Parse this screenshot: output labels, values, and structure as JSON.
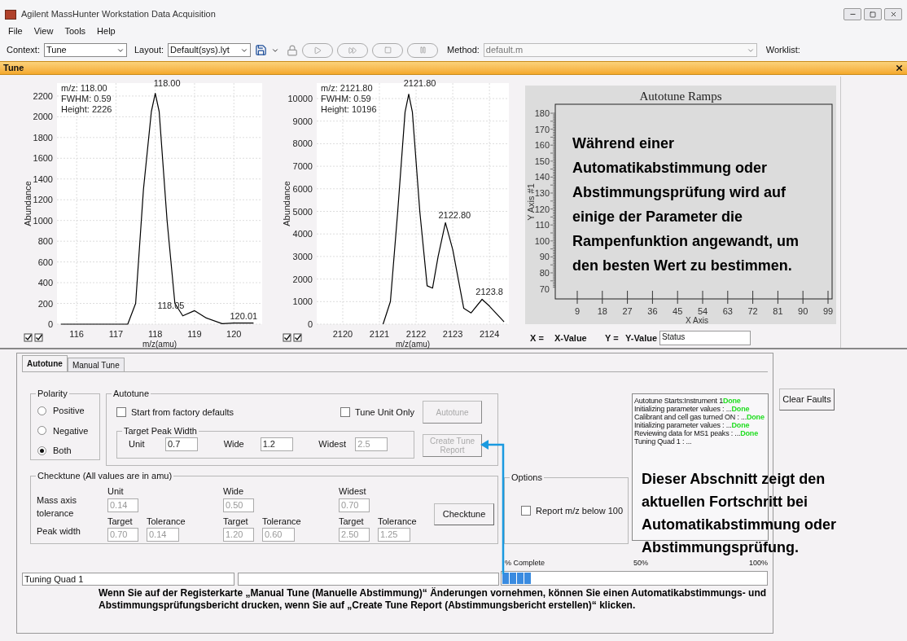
{
  "window": {
    "title": "Agilent MassHunter Workstation Data Acquisition"
  },
  "menu": [
    "File",
    "View",
    "Tools",
    "Help"
  ],
  "toolbar": {
    "context_label": "Context:",
    "context": "Tune",
    "layout_label": "Layout:",
    "layout": "Default(sys).lyt",
    "method_label": "Method:",
    "method": "default.m",
    "worklist_label": "Worklist:"
  },
  "panel_title": "Tune",
  "spectra": [
    {
      "info": [
        "m/z: 118.00",
        "FWHM: 0.59",
        "Height: 2226"
      ],
      "checks": [
        {
          "checked": true
        },
        {
          "checked": true
        }
      ],
      "chart_data": {
        "type": "line",
        "xlabel": "m/z(amu)",
        "ylabel": "Abundance",
        "x": [
          115.6,
          117.3,
          117.5,
          117.7,
          117.9,
          118.0,
          118.1,
          118.3,
          118.5,
          118.7,
          119.0,
          119.3,
          119.7,
          120.0,
          120.5
        ],
        "series": [
          {
            "color": "#000000",
            "values": [
              0,
              0,
              200,
              1300,
              2050,
              2226,
              2050,
              1000,
              200,
              80,
              130,
              60,
              5,
              10,
              10
            ]
          }
        ],
        "xlim": [
          115.5,
          120.72
        ],
        "ylim": [
          0,
          2325
        ],
        "xticks": [
          116,
          117,
          118,
          119,
          120
        ],
        "yticks": [
          0,
          200,
          400,
          600,
          800,
          1000,
          1200,
          1400,
          1600,
          1800,
          2000,
          2200
        ],
        "grid": true,
        "annotations": [
          "118.00",
          "118.05",
          "120.01"
        ]
      }
    },
    {
      "info": [
        "m/z: 2121.80",
        "FWHM: 0.59",
        "Height: 10196"
      ],
      "checks": [
        {
          "checked": true
        },
        {
          "checked": true
        }
      ],
      "chart_data": {
        "type": "line",
        "xlabel": "m/z(amu)",
        "ylabel": "Abundance",
        "x": [
          2121.1,
          2121.3,
          2121.5,
          2121.7,
          2121.8,
          2121.9,
          2122.1,
          2122.3,
          2122.45,
          2122.6,
          2122.8,
          2123.0,
          2123.3,
          2123.5,
          2123.8,
          2124.0,
          2124.4
        ],
        "series": [
          {
            "color": "#000000",
            "values": [
              0,
              1000,
              5000,
              9400,
              10196,
              9400,
              5000,
              1700,
              1600,
              3000,
              4500,
              3300,
              700,
              500,
              1100,
              800,
              100
            ]
          }
        ],
        "xlim": [
          2119.29,
          2124.53
        ],
        "ylim": [
          0,
          10686
        ],
        "xticks": [
          2120,
          2121,
          2122,
          2123,
          2124
        ],
        "yticks": [
          0,
          1000,
          2000,
          3000,
          4000,
          5000,
          6000,
          7000,
          8000,
          9000,
          10000
        ],
        "grid": true,
        "annotations": [
          "2121.80",
          "2122.80",
          "2123.8"
        ]
      }
    }
  ],
  "ramps": {
    "title": "Autotune Ramps",
    "ylabel": "Y Axis #1",
    "xlabel": "X Axis",
    "yticks": [
      "180",
      "170",
      "160",
      "150",
      "140",
      "130",
      "120",
      "110",
      "100",
      "90",
      "80",
      "70"
    ],
    "xticks": [
      "9",
      "18",
      "27",
      "36",
      "45",
      "54",
      "63",
      "72",
      "81",
      "90",
      "99"
    ],
    "x_label": "X =",
    "x_value": "X-Value",
    "y_label": "Y =",
    "y_value": "Y-Value",
    "status": "Status"
  },
  "tabs": [
    {
      "label": "Autotune",
      "selected": true
    },
    {
      "label": "Manual Tune",
      "selected": false
    }
  ],
  "polarity": {
    "title": "Polarity",
    "options": [
      {
        "label": "Positive",
        "selected": false
      },
      {
        "label": "Negative",
        "selected": false
      },
      {
        "label": "Both",
        "selected": true
      }
    ]
  },
  "autotune": {
    "title": "Autotune",
    "checkboxes": [
      {
        "label": "Start from factory defaults",
        "checked": false
      },
      {
        "label": "Tune Unit Only",
        "checked": false
      }
    ],
    "target_peak_width": {
      "title": "Target Peak Width",
      "fields": [
        {
          "label": "Unit",
          "value": "0.7",
          "disabled": false
        },
        {
          "label": "Wide",
          "value": "1.2",
          "disabled": false
        },
        {
          "label": "Widest",
          "value": "2.5",
          "disabled": true
        }
      ]
    },
    "buttons": [
      {
        "label": "Autotune",
        "disabled": true
      },
      {
        "label": "Create Tune Report",
        "disabled": true
      }
    ]
  },
  "checktune": {
    "title": "Checktune  (All values are in amu)",
    "mass_axis_label": "Mass axis tolerance",
    "peak_width_label": "Peak width",
    "columns": [
      {
        "label": "Unit",
        "mass_axis": "0.14",
        "target_label": "Target",
        "target": "0.70",
        "tolerance_label": "Tolerance",
        "tolerance": "0.14"
      },
      {
        "label": "Wide",
        "mass_axis": "0.50",
        "target_label": "Target",
        "target": "1.20",
        "tolerance_label": "Tolerance",
        "tolerance": "0.60"
      },
      {
        "label": "Widest",
        "mass_axis": "0.70",
        "target_label": "Target",
        "target": "2.50",
        "tolerance_label": "Tolerance",
        "tolerance": "1.25"
      }
    ],
    "button": "Checktune"
  },
  "options": {
    "title": "Options",
    "checkbox": {
      "label": "Report m/z below 100",
      "checked": false
    }
  },
  "log": [
    {
      "text": "Autotune Starts:Instrument 1",
      "status": "Done"
    },
    {
      "text": "Initializing parameter values  : ...",
      "status": "Done"
    },
    {
      "text": "Calibrant and cell gas turned ON  : ...",
      "status": "Done"
    },
    {
      "text": "Initializing parameter values  : ...",
      "status": "Done"
    },
    {
      "text": "Reviewing data for MS1 peaks  : ...",
      "status": "Done"
    },
    {
      "text": "Tuning Quad 1  : ..."
    }
  ],
  "clear_faults": "Clear Faults",
  "progress": {
    "label": "% Complete",
    "mid": "50%",
    "end": "100%",
    "level": 0.11
  },
  "status_bar": {
    "message": "Tuning Quad 1"
  },
  "callouts": [
    "Während einer Automatikabstimmung oder Abstimmungsprüfung wird auf einige der Parameter die Rampenfunktion angewandt, um den besten Wert zu bestimmen.",
    "Dieser Abschnitt zeigt den aktuellen Fortschritt bei Automatikabstimmung oder Abstimmungsprüfung.",
    "Wenn Sie auf der Registerkarte „Manual Tune (Manuelle Abstimmung)“ Änderungen vornehmen, können Sie einen Automatikabstimmungs- und Abstimmungsprüfungsbericht drucken, wenn Sie auf „Create Tune Report (Abstimmungsbericht erstellen)“ klicken."
  ]
}
